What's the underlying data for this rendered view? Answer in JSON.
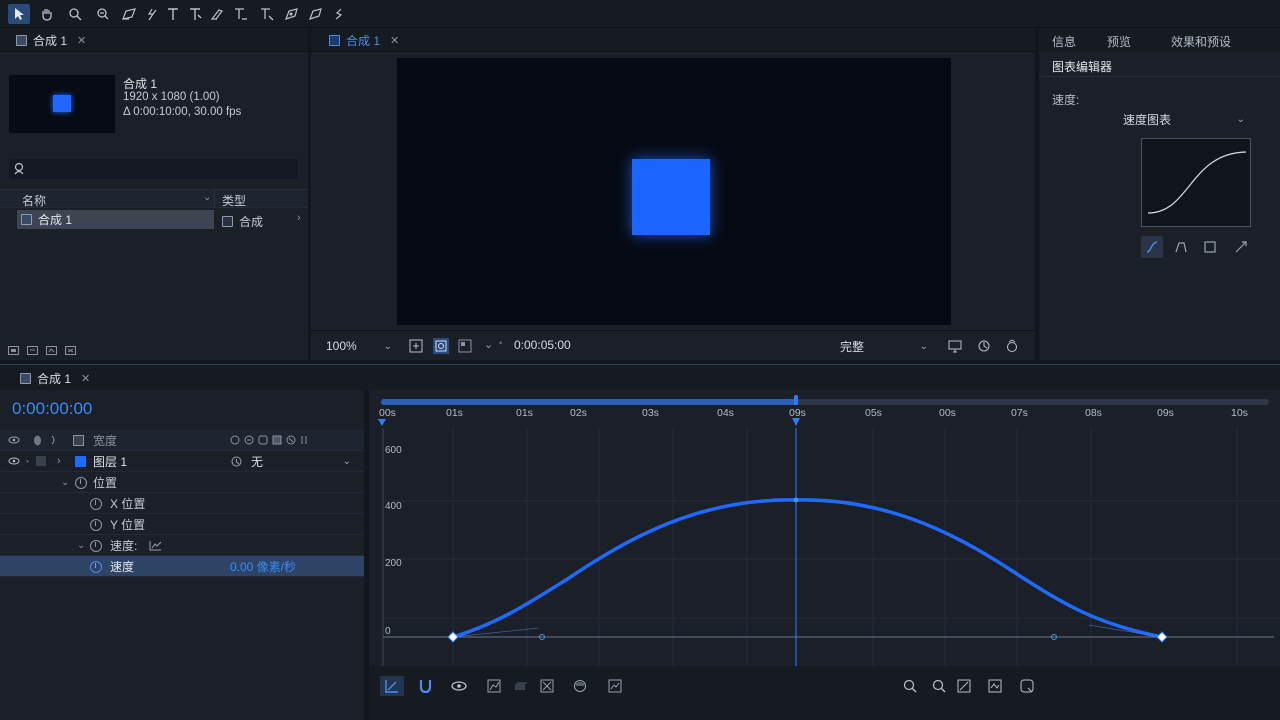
{
  "toolbar": {
    "tools": [
      "selection-tool",
      "hand-tool",
      "zoom-tool",
      "orbit-tool",
      "pen-tool",
      "puppet-tool",
      "text-tool",
      "vertical-text-tool",
      "brush-tool",
      "clone-tool",
      "eraser-tool",
      "roto-tool"
    ]
  },
  "project": {
    "tab_label": "合成 1",
    "comp_name": "合成 1",
    "comp_size": "1920 x 1080 (1.00)",
    "comp_duration": "Δ 0:00:10:00, 30.00 fps",
    "search_placeholder": "",
    "col_name": "名称",
    "col_type": "类型",
    "item_name": "合成 1",
    "item_type": "合成"
  },
  "viewer": {
    "tab_label": "合成 1",
    "zoom": "100%",
    "timecode": "0:00:05:00",
    "resolution": "完整"
  },
  "effects": {
    "tabs": [
      "信息",
      "预览",
      "效果和预设"
    ],
    "panel_title": "图表编辑器",
    "speed_label": "速度:",
    "graph_type": "速度图表"
  },
  "timeline": {
    "tab_label": "合成 1",
    "current_time": "0:00:00:00",
    "layer_header": "宽度",
    "ruler_labels": [
      "00s",
      "01s",
      "01s",
      "02s",
      "03s",
      "04s",
      "09s",
      "05s",
      "00s",
      "07s",
      "08s",
      "09s",
      "10s"
    ],
    "layer_name": "图层 1",
    "parent_value": "无",
    "prop_position": "位置",
    "prop_x": "X 位置",
    "prop_y": "Y 位置",
    "prop_speed_group": "速度:",
    "prop_speed": "速度",
    "speed_value": "0.00 像素/秒",
    "y_labels": [
      "600",
      "400",
      "200",
      "0"
    ]
  },
  "colors": {
    "accent": "#1f6bff",
    "panel": "#1a1f28",
    "selection": "#2d4466"
  }
}
